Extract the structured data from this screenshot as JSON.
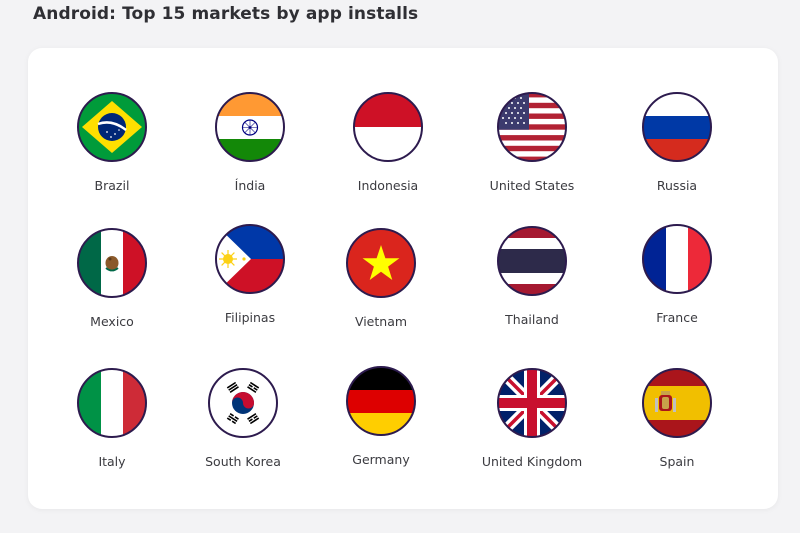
{
  "title": "Android: Top 15 markets by app installs",
  "markets": [
    {
      "name": "Brazil",
      "icon": "brazil-flag-icon"
    },
    {
      "name": "Índia",
      "icon": "india-flag-icon"
    },
    {
      "name": "Indonesia",
      "icon": "indonesia-flag-icon"
    },
    {
      "name": "United States",
      "icon": "united-states-flag-icon"
    },
    {
      "name": "Russia",
      "icon": "russia-flag-icon"
    },
    {
      "name": "Mexico",
      "icon": "mexico-flag-icon"
    },
    {
      "name": "Filipinas",
      "icon": "philippines-flag-icon"
    },
    {
      "name": "Vietnam",
      "icon": "vietnam-flag-icon"
    },
    {
      "name": "Thailand",
      "icon": "thailand-flag-icon"
    },
    {
      "name": "France",
      "icon": "france-flag-icon"
    },
    {
      "name": "Italy",
      "icon": "italy-flag-icon"
    },
    {
      "name": "South Korea",
      "icon": "south-korea-flag-icon"
    },
    {
      "name": "Germany",
      "icon": "germany-flag-icon"
    },
    {
      "name": "United Kingdom",
      "icon": "united-kingdom-flag-icon"
    },
    {
      "name": "Spain",
      "icon": "spain-flag-icon"
    }
  ],
  "colors": {
    "flag_border": "#2d1b4e",
    "title": "#2f2f34",
    "label": "#3b3b40",
    "card": "#ffffff",
    "background": "#f3f3f5"
  }
}
